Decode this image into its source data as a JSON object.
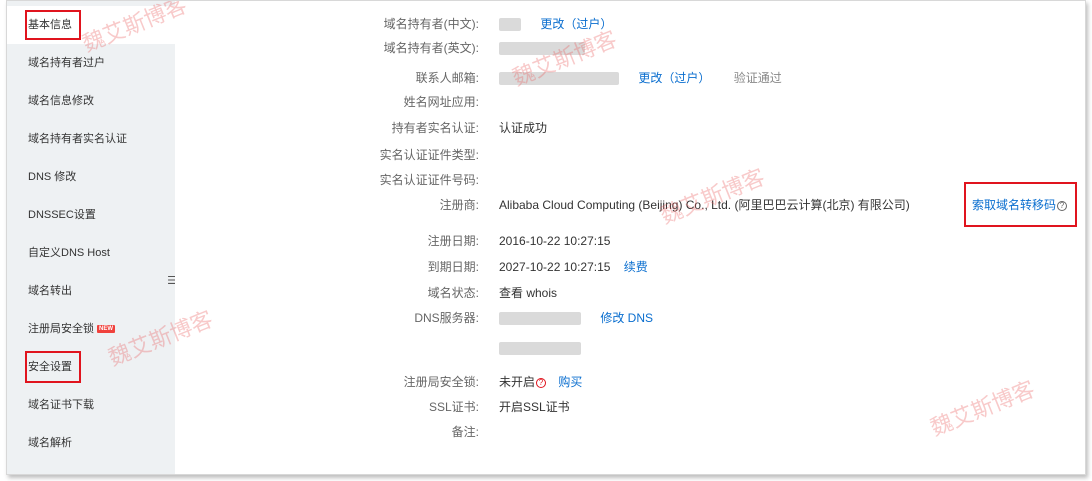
{
  "sidebar": {
    "items": [
      {
        "label": "基本信息",
        "active": true,
        "highlighted": true
      },
      {
        "label": "域名持有者过户"
      },
      {
        "label": "域名信息修改"
      },
      {
        "label": "域名持有者实名认证"
      },
      {
        "label": "DNS 修改"
      },
      {
        "label": "DNSSEC设置"
      },
      {
        "label": "自定义DNS Host"
      },
      {
        "label": "域名转出"
      },
      {
        "label": "注册局安全锁",
        "badge": "NEW"
      },
      {
        "label": "安全设置",
        "highlighted": true
      },
      {
        "label": "域名证书下载"
      },
      {
        "label": "域名解析"
      }
    ],
    "toggle_icon": "collapse-icon",
    "toggle_glyph": "☰"
  },
  "details": {
    "owner_cn": {
      "label": "域名持有者(中文):",
      "action": "更改（过户）"
    },
    "owner_en": {
      "label": "域名持有者(英文):"
    },
    "email": {
      "label": "联系人邮箱:",
      "action": "更改（过户）",
      "status": "验证通过"
    },
    "site_app": {
      "label": "姓名网址应用:"
    },
    "realname": {
      "label": "持有者实名认证:",
      "value": "认证成功"
    },
    "cert_type": {
      "label": "实名认证证件类型:"
    },
    "cert_no": {
      "label": "实名认证证件号码:"
    },
    "registrar": {
      "label": "注册商:",
      "value": "Alibaba Cloud Computing (Beijing) Co., Ltd. (阿里巴巴云计算(北京) 有限公司)",
      "action": "索取域名转移码"
    },
    "reg_date": {
      "label": "注册日期:",
      "value": "2016-10-22 10:27:15"
    },
    "exp_date": {
      "label": "到期日期:",
      "value": "2027-10-22 10:27:15",
      "action": "续费"
    },
    "status": {
      "label": "域名状态:",
      "action": "查看 whois"
    },
    "dns": {
      "label": "DNS服务器:",
      "action": "修改 DNS"
    },
    "lock": {
      "label": "注册局安全锁:",
      "value": "未开启",
      "action": "购买"
    },
    "ssl": {
      "label": "SSL证书:",
      "action": "开启SSL证书"
    },
    "remark": {
      "label": "备注:"
    }
  },
  "watermark": {
    "text": "魏艾斯博客",
    "color": "#e85a5a"
  },
  "colors": {
    "link": "#0a6ecf",
    "highlight_box": "#e0141e",
    "sidebar_bg": "#eef1f3"
  }
}
